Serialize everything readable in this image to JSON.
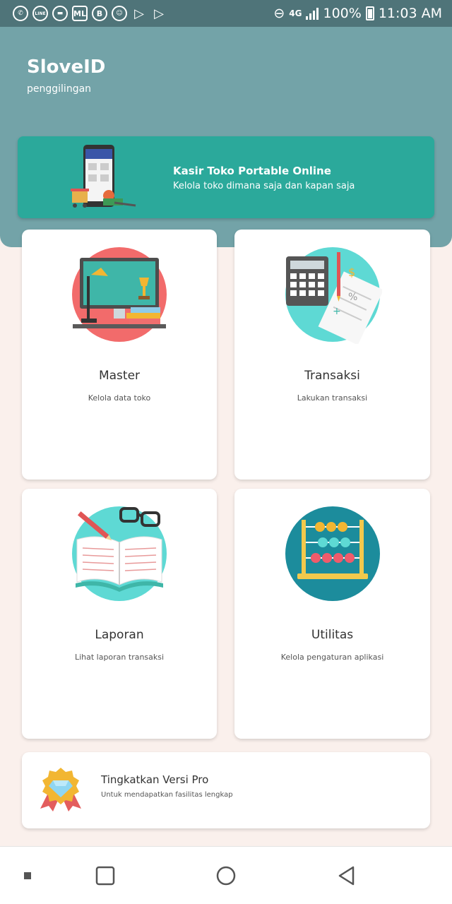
{
  "status_bar": {
    "app_icons": [
      "whatsapp-icon",
      "line-icon",
      "messages-icon",
      "ml-icon",
      "b-icon",
      "runner-icon",
      "play-store-icon",
      "play-store-icon"
    ],
    "line_label": "LINE",
    "ml_label": "ML",
    "b_label": "B",
    "network": "4G",
    "battery": "100%",
    "time": "11:03 AM"
  },
  "header": {
    "title": "SloveID",
    "subtitle": "penggilingan",
    "background": "#73a3a8"
  },
  "promo": {
    "title": "Kasir Toko Portable Online",
    "subtitle": "Kelola toko dimana saja dan kapan saja",
    "background": "#2ba99b"
  },
  "menu": [
    {
      "title": "Master",
      "desc": "Kelola data toko",
      "icon": "desk-computer-icon"
    },
    {
      "title": "Transaksi",
      "desc": "Lakukan transaksi",
      "icon": "calculator-icon"
    },
    {
      "title": "Laporan",
      "desc": "Lihat laporan transaksi",
      "icon": "book-report-icon"
    },
    {
      "title": "Utilitas",
      "desc": "Kelola pengaturan aplikasi",
      "icon": "abacus-icon"
    }
  ],
  "pro": {
    "title": "Tingkatkan Versi Pro",
    "subtitle": "Untuk mendapatkan fasilitas lengkap",
    "icon": "diamond-badge-icon"
  },
  "navbar": {
    "icons": [
      "menu-dot-icon",
      "recents-icon",
      "home-icon",
      "back-icon"
    ]
  }
}
